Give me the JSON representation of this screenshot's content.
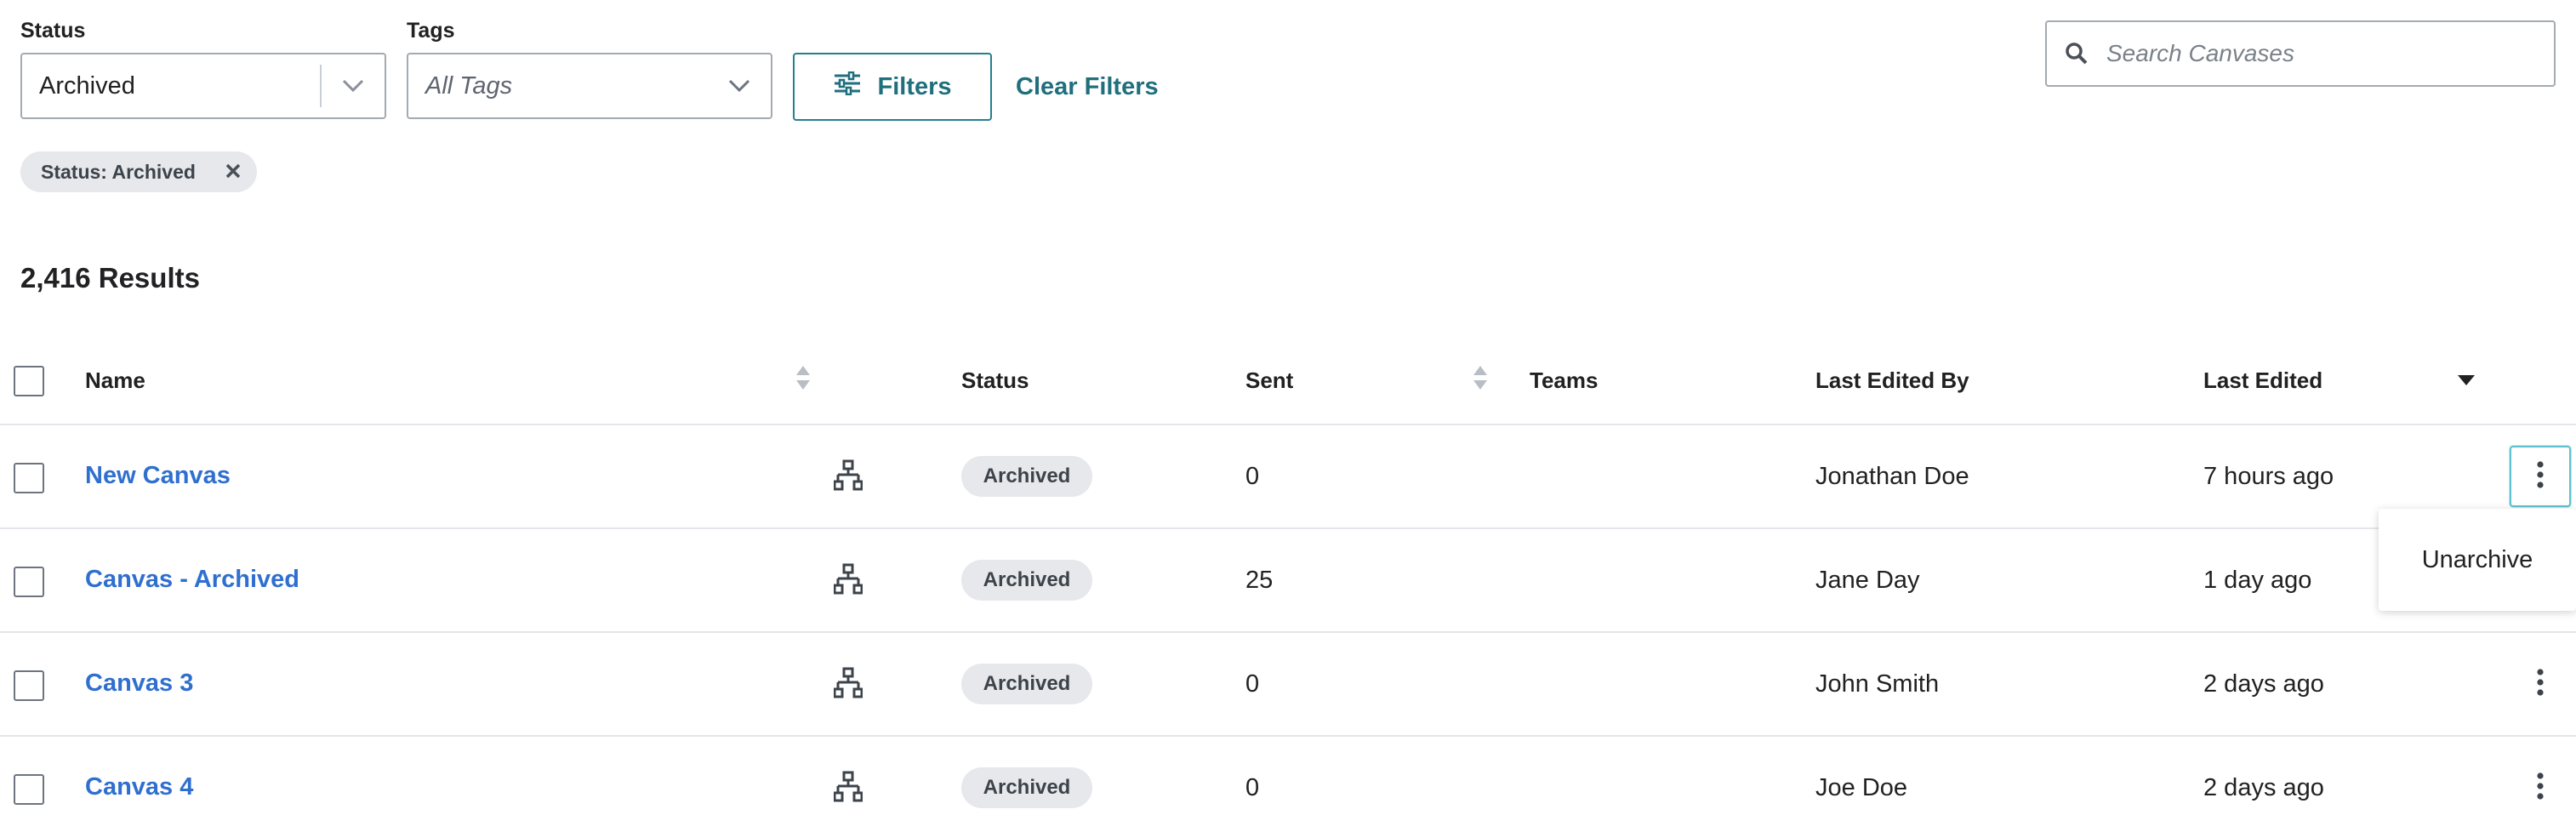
{
  "filters": {
    "status_label": "Status",
    "status_value": "Archived",
    "tags_label": "Tags",
    "tags_placeholder": "All Tags",
    "filters_button": "Filters",
    "clear_filters": "Clear Filters",
    "search_placeholder": "Search Canvases",
    "active_chip": "Status: Archived"
  },
  "results_count": "2,416 Results",
  "table": {
    "headers": {
      "name": "Name",
      "status": "Status",
      "sent": "Sent",
      "teams": "Teams",
      "last_edited_by": "Last Edited By",
      "last_edited": "Last Edited"
    },
    "rows": [
      {
        "name": "New Canvas",
        "status": "Archived",
        "sent": "0",
        "teams": "",
        "last_edited_by": "Jonathan Doe",
        "last_edited": "7 hours ago"
      },
      {
        "name": "Canvas - Archived",
        "status": "Archived",
        "sent": "25",
        "teams": "",
        "last_edited_by": "Jane Day",
        "last_edited": "1 day ago"
      },
      {
        "name": "Canvas 3",
        "status": "Archived",
        "sent": "0",
        "teams": "",
        "last_edited_by": "John Smith",
        "last_edited": "2 days ago"
      },
      {
        "name": "Canvas 4",
        "status": "Archived",
        "sent": "0",
        "teams": "",
        "last_edited_by": "Joe Doe",
        "last_edited": "2 days ago"
      }
    ]
  },
  "row_menu": {
    "items": [
      "Unarchive"
    ]
  },
  "icons": {
    "select_chevron": "chevron-down-icon",
    "filters": "sliders-icon",
    "search": "search-icon",
    "chip_remove": "close-icon",
    "sort": "sort-icon",
    "canvas_type": "flow-icon",
    "row_actions": "kebab-icon"
  },
  "colors": {
    "accent": "#23808f",
    "link": "#2f6fcf",
    "badge_bg": "#e6e8eb",
    "menu_focus": "#5ec2cf"
  }
}
